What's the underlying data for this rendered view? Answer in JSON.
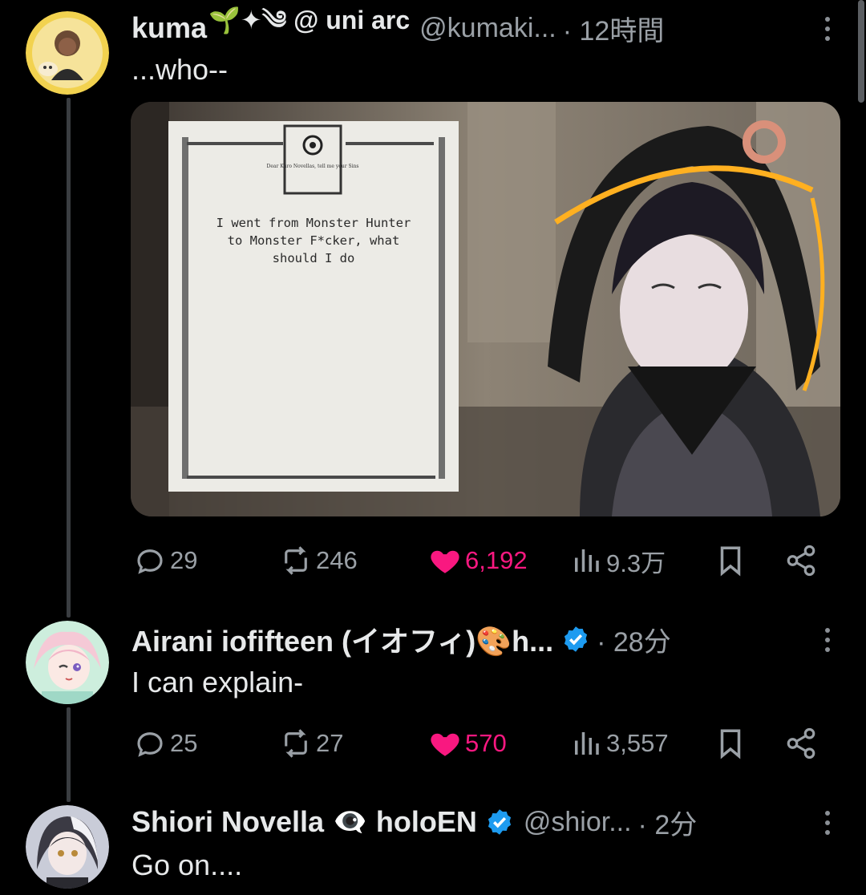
{
  "posts": [
    {
      "name": "kuma",
      "name_suffix": "🌱✦༄ @ uni arc",
      "handle": "@kumaki...",
      "time": "· 12時間",
      "text": "...who--",
      "media": {
        "letter_header_small": "Dear Kuro Novellas, tell me your Sins",
        "letter_text": [
          "I went from Monster Hunter",
          "to Monster F*cker, what",
          "should I do"
        ]
      },
      "stats": {
        "replies": "29",
        "reposts": "246",
        "likes": "6,192",
        "views": "9.3万"
      },
      "liked": true
    },
    {
      "name": "Airani iofifteen (イオフィ)🎨h...",
      "handle": "",
      "time": "· 28分",
      "text": "I can explain-",
      "verified": true,
      "stats": {
        "replies": "25",
        "reposts": "27",
        "likes": "570",
        "views": "3,557"
      },
      "liked": true
    },
    {
      "name": "Shiori Novella 👁‍🗨 holoEN",
      "handle": "@shior...",
      "time": "· 2分",
      "text": "Go on....",
      "verified": true
    }
  ],
  "colors": {
    "like_pink": "#f91880",
    "verified_blue": "#1d9bf0",
    "muted_text": "#9aa0a6",
    "thread_line": "#3a3d41"
  },
  "icons": [
    "reply-icon",
    "repost-icon",
    "heart-icon",
    "views-icon",
    "bookmark-icon",
    "share-icon",
    "more-icon",
    "verified-badge-icon"
  ]
}
